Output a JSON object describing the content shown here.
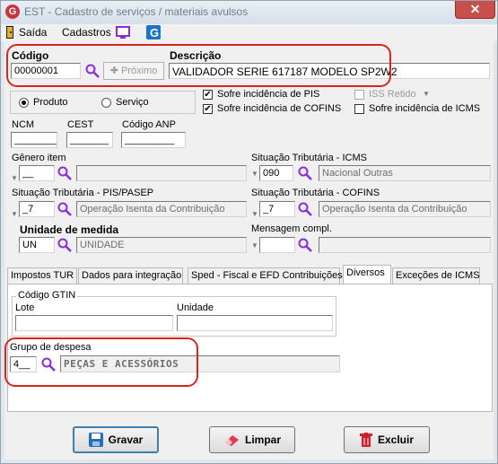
{
  "window": {
    "title": "EST - Cadastro de serviços / materiais avulsos",
    "close_glyph": "✕"
  },
  "menu": {
    "exit": "Saída",
    "cadastros": "Cadastros"
  },
  "header": {
    "codigo_label": "Código",
    "codigo_value": "00000001",
    "proximo_label": "Próximo",
    "descricao_label": "Descrição",
    "descricao_value": "VALIDADOR SERIE 617187 MODELO SP2W2"
  },
  "tipo": {
    "produto": "Produto",
    "servico": "Serviço",
    "selected": "Produto"
  },
  "checks": {
    "pis": {
      "label": "Sofre incidência de PIS",
      "checked": true
    },
    "cofins": {
      "label": "Sofre incidência de COFINS",
      "checked": true
    },
    "iss": {
      "label": "ISS Retido",
      "checked": false
    },
    "icms": {
      "label": "Sofre incidência de ICMS",
      "checked": false
    }
  },
  "fiscal": {
    "ncm_label": "NCM",
    "ncm_value": "________",
    "cest_label": "CEST",
    "cest_value": "_______",
    "anp_label": "Código ANP",
    "anp_value": "_________"
  },
  "genero": {
    "label": "Gênero item",
    "code": "__",
    "desc": ""
  },
  "icms": {
    "label": "Situação Tributária - ICMS",
    "code": "090",
    "desc": "Nacional Outras"
  },
  "pis": {
    "label": "Situação Tributária - PIS/PASEP",
    "code": "_7",
    "desc": "Operação Isenta da Contribuição"
  },
  "cofins": {
    "label": "Situação Tributária - COFINS",
    "code": "_7",
    "desc": "Operação Isenta da Contribuição"
  },
  "unidade": {
    "label": "Unidade de medida",
    "code": "UN",
    "desc": "UNIDADE"
  },
  "mensagem": {
    "label": "Mensagem compl.",
    "code": "",
    "desc": ""
  },
  "tabs": [
    {
      "label": "Impostos TUR"
    },
    {
      "label": "Dados para integração"
    },
    {
      "label": "Sped - Fiscal e EFD Contribuições"
    },
    {
      "label": "Diversos"
    },
    {
      "label": "Exceções de ICMS"
    }
  ],
  "diversos": {
    "gtin_group": "Código GTIN",
    "lote_label": "Lote",
    "lote_value": "",
    "unidade_label": "Unidade",
    "unidade_value": "",
    "grupo_label": "Grupo de despesa",
    "grupo_code": "4__",
    "grupo_desc": "PEÇAS E ACESSÓRIOS"
  },
  "buttons": {
    "gravar": "Gravar",
    "limpar": "Limpar",
    "excluir": "Excluir"
  },
  "colors": {
    "highlight": "#d9261c",
    "titlebar_text": "#6f7e8c",
    "close": "#c7504a"
  }
}
